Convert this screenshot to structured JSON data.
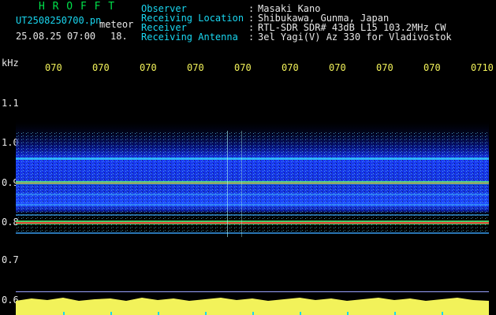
{
  "header": {
    "title": "H R O F F T",
    "file": "UT2508250700.pn",
    "tag": "meteor",
    "datetime": "25.08.25 07:00",
    "counter": "18.",
    "rows": [
      {
        "label": "Observer",
        "sep": ":",
        "value": "Masaki Kano"
      },
      {
        "label": "Receiving Location",
        "sep": ":",
        "value": "Shibukawa, Gunma, Japan"
      },
      {
        "label": "Receiver",
        "sep": ":",
        "value": "RTL-SDR SDR# 43dB L15 103.2MHz CW"
      },
      {
        "label": "Receiving Antenna",
        "sep": ":",
        "value": "3el Yagi(V) Az 330 for Vladivostok"
      }
    ]
  },
  "axis": {
    "unit": "kHz",
    "y_ticks": [
      "1.1",
      "1.0",
      "0.9",
      "0.8",
      "0.7",
      "0.6"
    ],
    "x_ticks": [
      "070",
      "070",
      "070",
      "070",
      "070",
      "070",
      "070",
      "070",
      "070",
      "0710"
    ]
  },
  "colors": {
    "title": "#00e04a",
    "labels": "#19d6f0",
    "values": "#e8e8e8",
    "time_ticks": "#f2f25a",
    "noise_band": "#1a3cff",
    "signal_line": "#ff3030",
    "baseline": "#f2f25a"
  }
}
